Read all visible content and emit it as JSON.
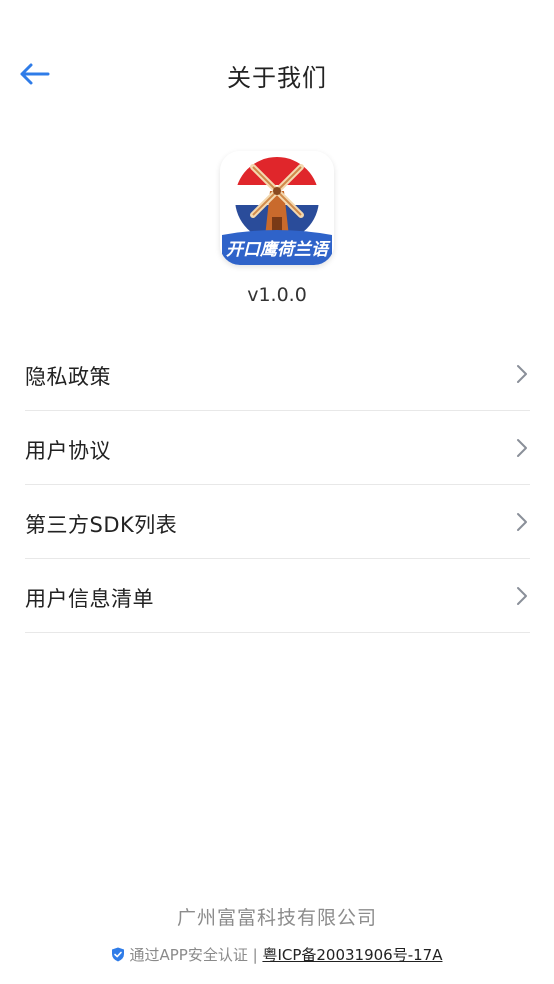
{
  "header": {
    "title": "关于我们",
    "back_icon": "arrow-left-icon"
  },
  "app": {
    "logo_text": "开口鹰荷兰语",
    "version": "v1.0.0"
  },
  "menu": {
    "items": [
      {
        "label": "隐私政策",
        "icon": "chevron-right-icon"
      },
      {
        "label": "用户协议",
        "icon": "chevron-right-icon"
      },
      {
        "label": "第三方SDK列表",
        "icon": "chevron-right-icon"
      },
      {
        "label": "用户信息清单",
        "icon": "chevron-right-icon"
      }
    ]
  },
  "footer": {
    "company": "广州富富科技有限公司",
    "verified_text": "通过APP安全认证 | ",
    "icp": "粤ICP备20031906号-17A",
    "shield_icon": "shield-check-icon"
  },
  "colors": {
    "accent": "#2f7ce8",
    "text": "#222222",
    "muted": "#8c8c8c",
    "divider": "#e8e8e8"
  }
}
